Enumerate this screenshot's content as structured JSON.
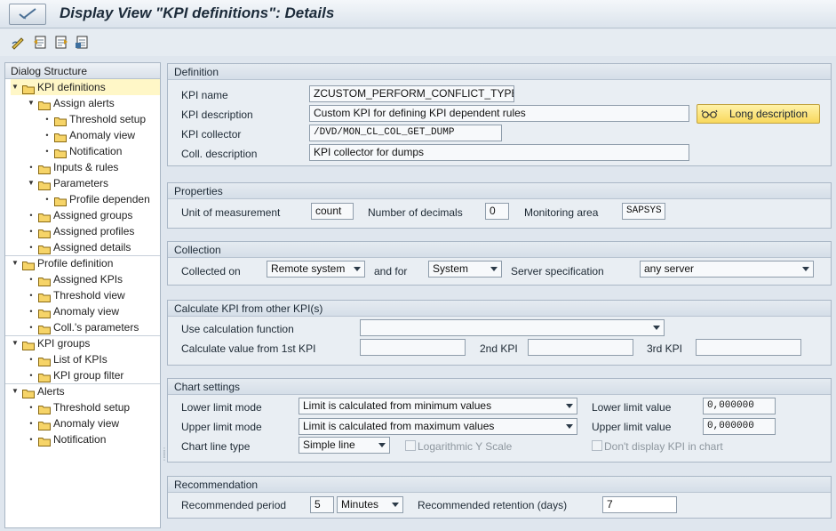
{
  "window": {
    "title": "Display View \"KPI definitions\": Details"
  },
  "nav": {
    "header": "Dialog Structure",
    "items": [
      {
        "label": "KPI definitions",
        "toggle": "▼",
        "selected": true
      },
      {
        "label": "Assign alerts",
        "toggle": "▼"
      },
      {
        "label": "Threshold setup",
        "toggle": "•"
      },
      {
        "label": "Anomaly view",
        "toggle": "•"
      },
      {
        "label": "Notification",
        "toggle": "•"
      },
      {
        "label": "Inputs & rules",
        "toggle": "•"
      },
      {
        "label": "Parameters",
        "toggle": "▼"
      },
      {
        "label": "Profile dependen",
        "toggle": "•"
      },
      {
        "label": "Assigned groups",
        "toggle": "•"
      },
      {
        "label": "Assigned profiles",
        "toggle": "•"
      },
      {
        "label": "Assigned details",
        "toggle": "•"
      },
      {
        "label": "Profile definition",
        "toggle": "▼"
      },
      {
        "label": "Assigned KPIs",
        "toggle": "•"
      },
      {
        "label": "Threshold view",
        "toggle": "•"
      },
      {
        "label": "Anomaly view",
        "toggle": "•"
      },
      {
        "label": "Coll.'s parameters",
        "toggle": "•"
      },
      {
        "label": "KPI groups",
        "toggle": "▼"
      },
      {
        "label": "List of KPIs",
        "toggle": "•"
      },
      {
        "label": "KPI group filter",
        "toggle": "•"
      },
      {
        "label": "Alerts",
        "toggle": "▼"
      },
      {
        "label": "Threshold setup",
        "toggle": "•"
      },
      {
        "label": "Anomaly view",
        "toggle": "•"
      },
      {
        "label": "Notification",
        "toggle": "•"
      }
    ]
  },
  "definition": {
    "title": "Definition",
    "kpi_name_label": "KPI name",
    "kpi_name": "ZCUSTOM_PERFORM_CONFLICT_TYPE",
    "kpi_description_label": "KPI description",
    "kpi_description": "Custom KPI for defining KPI dependent rules",
    "long_description_button": "Long description",
    "kpi_collector_label": "KPI collector",
    "kpi_collector": "/DVD/MON_CL_COL_GET_DUMP",
    "coll_description_label": "Coll. description",
    "coll_description": "KPI collector for dumps"
  },
  "properties": {
    "title": "Properties",
    "uom_label": "Unit of measurement",
    "uom": "count",
    "decimals_label": "Number of decimals",
    "decimals": "0",
    "monitoring_area_label": "Monitoring area",
    "monitoring_area": "SAPSYS"
  },
  "collection": {
    "title": "Collection",
    "collected_on_label": "Collected on",
    "collected_on": "Remote system",
    "and_for_label": "and for",
    "and_for": "System",
    "server_spec_label": "Server specification",
    "server_spec": "any server"
  },
  "calculate": {
    "title": "Calculate KPI from other KPI(s)",
    "use_function_label": "Use calculation function",
    "use_function": "",
    "first_kpi_label": "Calculate value from 1st KPI",
    "first_kpi": "",
    "second_kpi_label": "2nd KPI",
    "second_kpi": "",
    "third_kpi_label": "3rd KPI",
    "third_kpi": ""
  },
  "chart": {
    "title": "Chart settings",
    "lower_mode_label": "Lower limit mode",
    "lower_mode": "Limit is calculated from minimum values",
    "lower_value_label": "Lower limit value",
    "lower_value": "0,000000",
    "upper_mode_label": "Upper limit mode",
    "upper_mode": "Limit is calculated from maximum values",
    "upper_value_label": "Upper limit value",
    "upper_value": "0,000000",
    "line_type_label": "Chart line type",
    "line_type": "Simple line",
    "log_scale_label": "Logarithmic Y Scale",
    "dont_display_label": "Don't display KPI in chart"
  },
  "recommendation": {
    "title": "Recommendation",
    "period_label": "Recommended period",
    "period_value": "5",
    "period_unit": "Minutes",
    "retention_label": "Recommended retention (days)",
    "retention_value": "7"
  }
}
